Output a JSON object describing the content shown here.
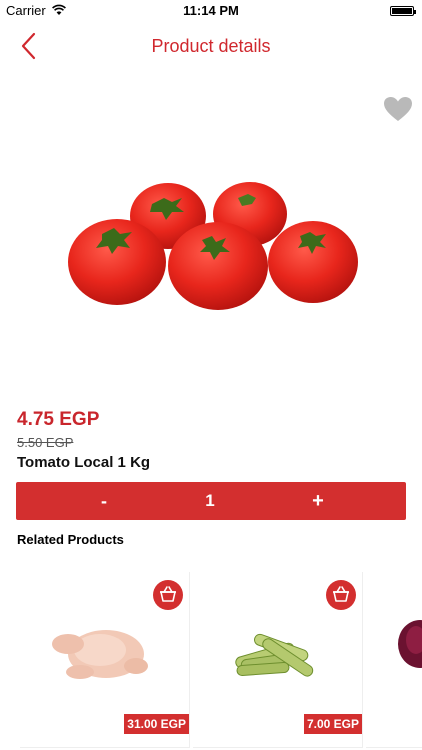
{
  "status_bar": {
    "carrier": "Carrier",
    "time": "11:14 PM"
  },
  "nav": {
    "title": "Product details"
  },
  "product": {
    "image_icon": "tomatoes-image",
    "price": "4.75 EGP",
    "old_price": "5.50 EGP",
    "name": "Tomato Local 1 Kg",
    "favorite_icon": "heart-icon"
  },
  "quantity": {
    "minus": "-",
    "value": "1",
    "plus": "+"
  },
  "related": {
    "title": "Related Products",
    "items": [
      {
        "image_icon": "chicken-image",
        "price": "31.00 EGP"
      },
      {
        "image_icon": "zucchini-image",
        "price": "7.00 EGP"
      },
      {
        "image_icon": "red-onion-image"
      }
    ]
  },
  "colors": {
    "accent": "#d32f2f",
    "title": "#d0282e",
    "price": "#c9262c"
  }
}
